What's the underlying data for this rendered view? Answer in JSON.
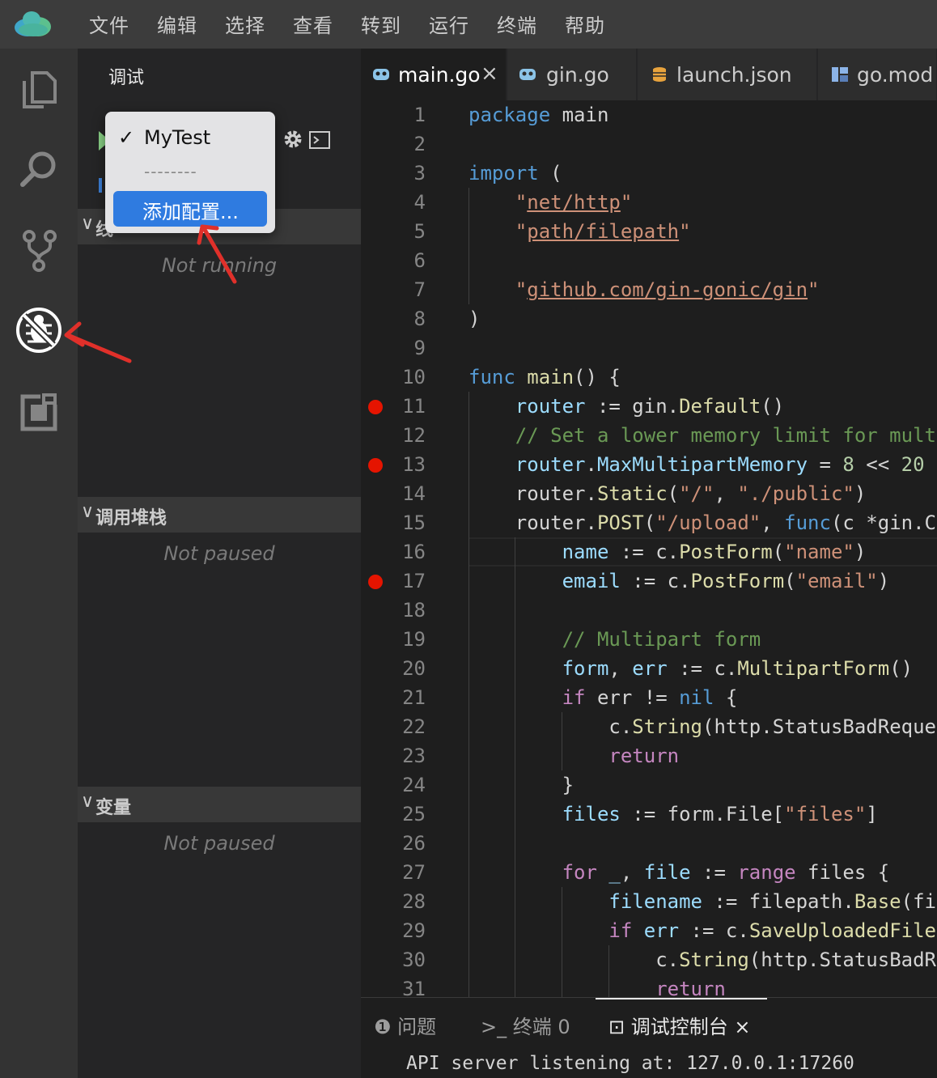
{
  "menubar": {
    "items": [
      "文件",
      "编辑",
      "选择",
      "查看",
      "转到",
      "运行",
      "终端",
      "帮助"
    ]
  },
  "activitybar": {
    "icons": [
      "files-icon",
      "search-icon",
      "source-control-icon",
      "debug-icon",
      "extensions-icon"
    ],
    "active": "debug-icon"
  },
  "sidebar": {
    "title": "调试",
    "sections": [
      {
        "title": "线程",
        "visible_title": "线",
        "placeholder": "Not running"
      },
      {
        "title": "调用堆栈",
        "placeholder": "Not paused"
      },
      {
        "title": "变量",
        "placeholder": "Not paused"
      }
    ]
  },
  "config_dropdown": {
    "selected": "MyTest",
    "separator": "--------",
    "add_label": "添加配置..."
  },
  "tabs": [
    {
      "label": "main.go",
      "active": true,
      "close": "×"
    },
    {
      "label": "gin.go",
      "active": false
    },
    {
      "label": "launch.json",
      "active": false
    },
    {
      "label": "go.mod",
      "active": false
    }
  ],
  "editor": {
    "current_line": 16,
    "breakpoints": [
      11,
      13,
      17
    ],
    "lines": [
      "package main",
      "",
      "import (",
      "    \"net/http\"",
      "    \"path/filepath\"",
      "",
      "    \"github.com/gin-gonic/gin\"",
      ")",
      "",
      "func main() {",
      "    router := gin.Default()",
      "    // Set a lower memory limit for mult",
      "    router.MaxMultipartMemory = 8 << 20",
      "    router.Static(\"/\", \"./public\")",
      "    router.POST(\"/upload\", func(c *gin.C",
      "        name := c.PostForm(\"name\")",
      "        email := c.PostForm(\"email\")",
      "",
      "        // Multipart form",
      "        form, err := c.MultipartForm()",
      "        if err != nil {",
      "            c.String(http.StatusBadReque",
      "            return",
      "        }",
      "        files := form.File[\"files\"]",
      "",
      "        for _, file := range files {",
      "            filename := filepath.Base(fi",
      "            if err := c.SaveUploadedFile",
      "                c.String(http.StatusBadR",
      "                return"
    ]
  },
  "panel": {
    "tabs": [
      {
        "label": "问题",
        "icon": "error-icon"
      },
      {
        "label": "终端",
        "count": "0",
        "icon": "terminal-icon"
      },
      {
        "label": "调试控制台",
        "icon": "console-icon",
        "active": true,
        "close": "×"
      }
    ],
    "output": "API server listening at: 127.0.0.1:17260"
  },
  "annotations": {
    "arrow_color": "#e0302a"
  }
}
